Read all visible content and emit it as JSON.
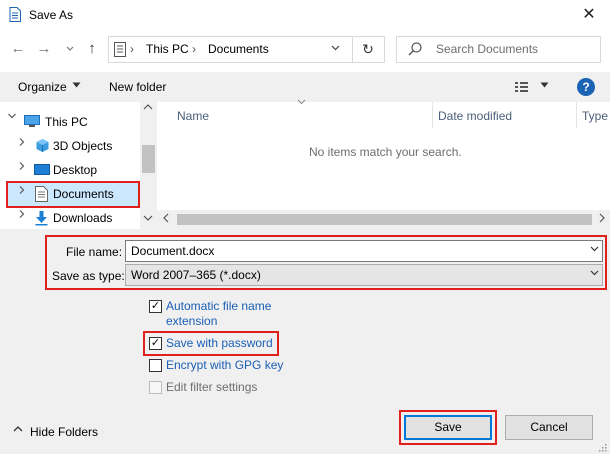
{
  "window": {
    "title": "Save As",
    "close_glyph": "✕"
  },
  "nav": {
    "back_glyph": "←",
    "forward_glyph": "→",
    "recent_glyph": "⌄",
    "up_glyph": "↑",
    "breadcrumb": [
      "This PC",
      "Documents"
    ],
    "separator": "›",
    "refresh_glyph": "↻",
    "search_placeholder": "Search Documents"
  },
  "toolbar": {
    "organize": "Organize",
    "new_folder": "New folder",
    "help": "?"
  },
  "tree": {
    "this_pc": "This PC",
    "items": [
      "3D Objects",
      "Desktop",
      "Documents",
      "Downloads"
    ],
    "selected": "Documents"
  },
  "file_list": {
    "columns": [
      "Name",
      "Date modified",
      "Type"
    ],
    "empty_message": "No items match your search."
  },
  "form": {
    "file_name_label": "File name:",
    "file_name_value": "Document.docx",
    "save_type_label": "Save as type:",
    "save_type_value": "Word 2007–365 (*.docx)"
  },
  "options": [
    {
      "label": "Automatic file name extension",
      "checked": true,
      "enabled": true
    },
    {
      "label": "Save with password",
      "checked": true,
      "enabled": true
    },
    {
      "label": "Encrypt with GPG key",
      "checked": false,
      "enabled": true
    },
    {
      "label": "Edit filter settings",
      "checked": false,
      "enabled": false
    }
  ],
  "footer": {
    "hide_folders": "Hide Folders",
    "save": "Save",
    "cancel": "Cancel"
  },
  "colors": {
    "accent": "#0078d7",
    "highlight_border": "#e0201a",
    "selection": "#cce8ff",
    "link": "#1a5fb4"
  }
}
